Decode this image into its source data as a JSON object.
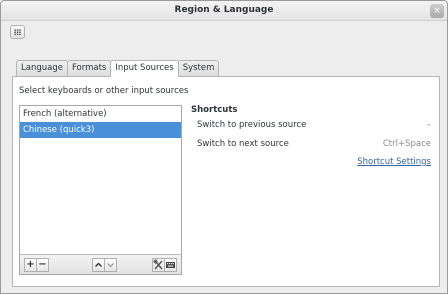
{
  "window": {
    "title": "Region & Language",
    "close_symbol": "×"
  },
  "tabs": [
    {
      "label": "Language",
      "active": false
    },
    {
      "label": "Formats",
      "active": false
    },
    {
      "label": "Input Sources",
      "active": true
    },
    {
      "label": "System",
      "active": false
    }
  ],
  "input_sources": {
    "instruction": "Select keyboards or other input sources",
    "items": [
      {
        "label": "French (alternative)",
        "selected": false
      },
      {
        "label": "Chinese (quick3)",
        "selected": true
      }
    ],
    "toolbar": {
      "add": "+",
      "remove": "−",
      "up": "⌃",
      "down": "⌄"
    }
  },
  "shortcuts": {
    "title": "Shortcuts",
    "rows": [
      {
        "label": "Switch to previous source",
        "accel": "–"
      },
      {
        "label": "Switch to next source",
        "accel": "Ctrl+Space"
      }
    ],
    "settings_link": "Shortcut Settings"
  },
  "colors": {
    "selection": "#4a90d9",
    "link": "#3465a4"
  }
}
